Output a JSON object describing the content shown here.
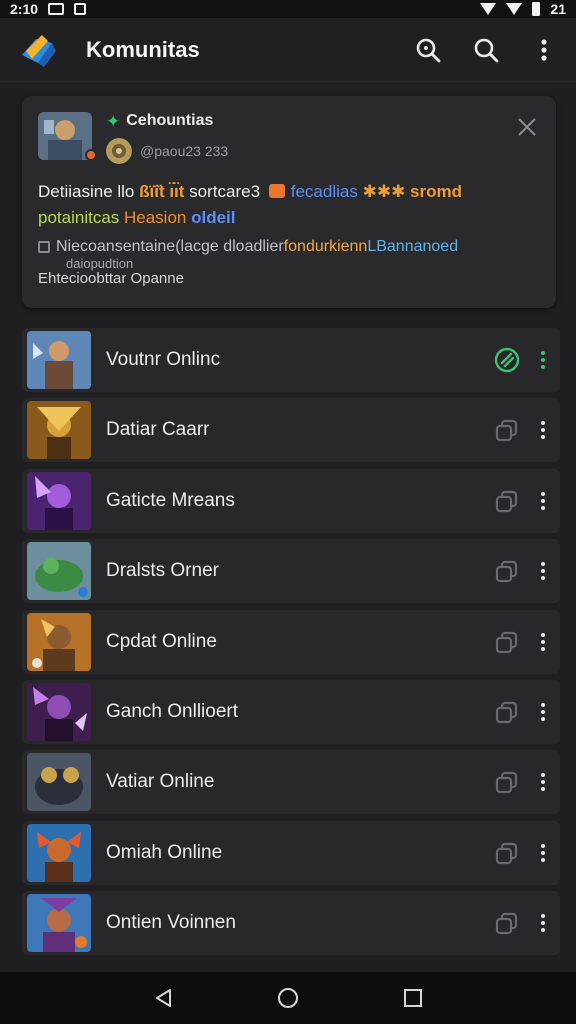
{
  "status_bar": {
    "time": "2:10",
    "battery_text": "21"
  },
  "app_bar": {
    "title": "Komunitas"
  },
  "featured": {
    "name": "Cehountias",
    "handle": "@paou23 233",
    "line1": {
      "a": "Detiiasine llo ",
      "b": "ßϊϊ̈t ı̈ı̈t",
      "c": " sortcare3 ",
      "d": "fecadlias",
      "e": " ✱✱✱ ",
      "f": "sromd"
    },
    "line2": {
      "a": "potainitcas ",
      "b": "Heasion",
      "c": " oldeil"
    },
    "line3": {
      "a": "Niecoansentaine(lacge dloadlier ",
      "b": "fondurkienn",
      "c": " LBannanoed"
    },
    "line4_top": "daiopudtion",
    "line4": "Ehtecioobttar Opanne"
  },
  "list": [
    {
      "label": "Voutnr Onlinc",
      "status": "active"
    },
    {
      "label": "Datiar Caarr",
      "status": "idle"
    },
    {
      "label": "Gaticte Mreans",
      "status": "idle"
    },
    {
      "label": "Dralsts Orner",
      "status": "idle"
    },
    {
      "label": "Cpdat  Online",
      "status": "idle"
    },
    {
      "label": "Ganch Onllioert",
      "status": "idle"
    },
    {
      "label": "Vatiar Online",
      "status": "idle"
    },
    {
      "label": "Omiah Online",
      "status": "idle"
    },
    {
      "label": "Ontien Voinnen",
      "status": "idle"
    }
  ],
  "colors": {
    "accent": "#3bc272",
    "background": "#1f1f21",
    "card": "#2a2a2d"
  },
  "icons": [
    "logo-icon",
    "search-icon",
    "more-vert-icon",
    "close-icon",
    "link-icon",
    "copy-icon",
    "back-icon",
    "home-icon",
    "recents-icon"
  ]
}
